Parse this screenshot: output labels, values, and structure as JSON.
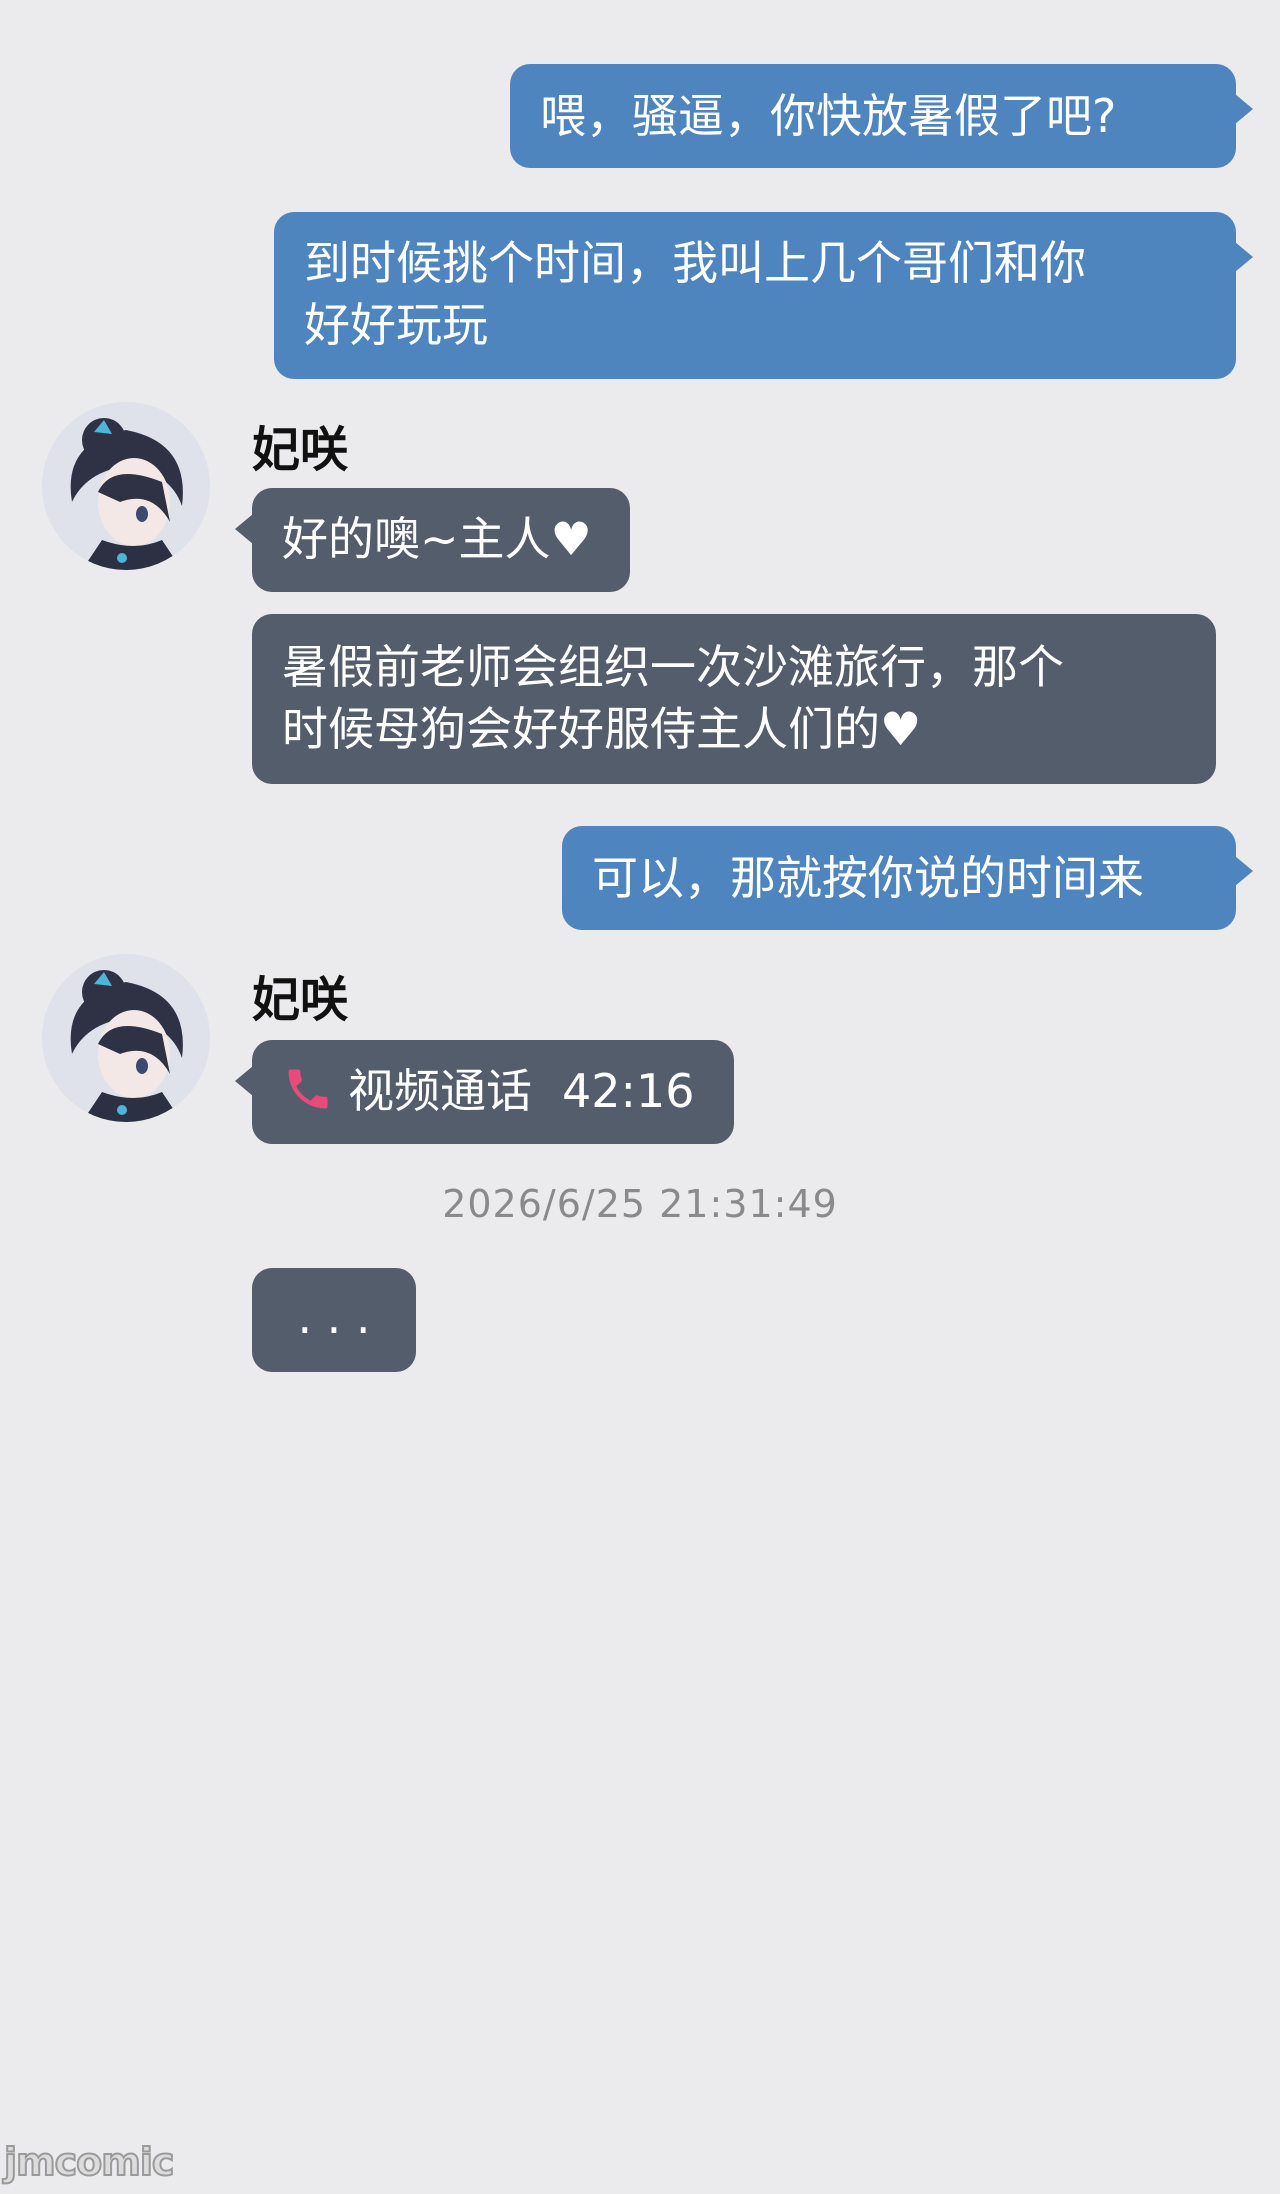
{
  "messages": [
    {
      "id": "m1",
      "direction": "out",
      "text": "喂，骚逼，你快放暑假了吧?"
    },
    {
      "id": "m2",
      "direction": "out",
      "text_line1": "到时候挑个时间，我叫上几个哥们和你",
      "text_line2": "好好玩玩"
    },
    {
      "id": "m3",
      "direction": "in",
      "sender": "妃咲",
      "text": "好的噢~主人♥"
    },
    {
      "id": "m4",
      "direction": "in",
      "text_line1": "暑假前老师会组织一次沙滩旅行，那个",
      "text_line2": "时候母狗会好好服侍主人们的♥"
    },
    {
      "id": "m5",
      "direction": "out",
      "text": "可以，那就按你说的时间来"
    },
    {
      "id": "m6",
      "direction": "in",
      "sender": "妃咲",
      "call_label": "视频通话",
      "call_duration": "42:16",
      "icon": "phone-icon"
    },
    {
      "id": "m7",
      "direction": "in",
      "text": ". . ."
    }
  ],
  "timestamp": "2026/6/25  21:31:49",
  "watermark": "jmcomic",
  "colors": {
    "background": "#ebebed",
    "outgoing": "#4f85bf",
    "incoming": "#535d6c",
    "phone_icon": "#e64b7a"
  }
}
